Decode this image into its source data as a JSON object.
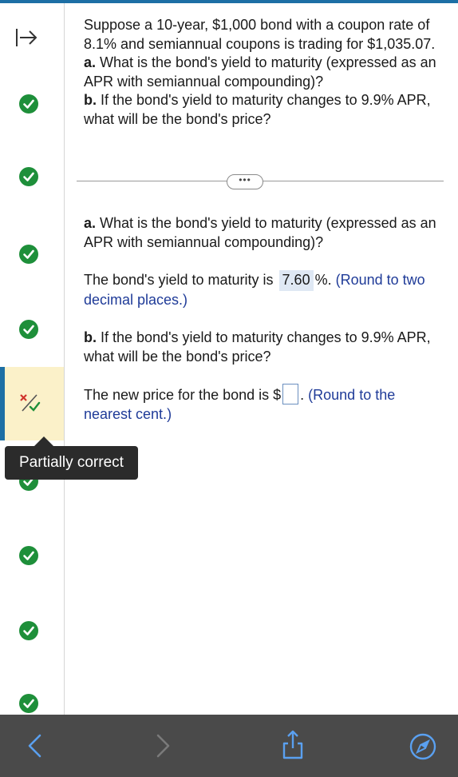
{
  "question": {
    "intro": "Suppose a 10-year, $1,000 bond with a coupon rate of 8.1% and semiannual coupons is trading for $1,035.07.",
    "part_a_label": "a.",
    "part_a_text": " What is the bond's yield to maturity (expressed as an APR with semiannual compounding)?",
    "part_b_label": "b.",
    "part_b_text": " If the bond's yield to maturity changes to 9.9% APR, what will be the bond's price?"
  },
  "work": {
    "a_label": "a.",
    "a_text": " What is the bond's yield to maturity (expressed as an APR with semiannual compounding)?",
    "a_answer_prefix": "The bond's yield to maturity is ",
    "a_answer_value": "7.60",
    "a_answer_suffix": "%. ",
    "a_hint": "(Round to two decimal places.)",
    "b_label": "b.",
    "b_text": " If the bond's yield to maturity changes to 9.9% APR, what will  be the bond's price?",
    "b_answer_prefix": "The new price for the bond is $",
    "b_answer_suffix": ". ",
    "b_hint": "(Round to the nearest cent.)"
  },
  "sidebar": {
    "tooltip": "Partially correct",
    "expand_icon": "expand-arrow-icon",
    "check_icon": "check-circle-icon",
    "partial_icon": "partially-correct-icon"
  },
  "colors": {
    "accent": "#1d6fa5",
    "correct": "#1e8f3a",
    "partial_bg": "#fbf1c9",
    "hint": "#1f3b98",
    "bottom_bar": "#4a4a4a"
  }
}
